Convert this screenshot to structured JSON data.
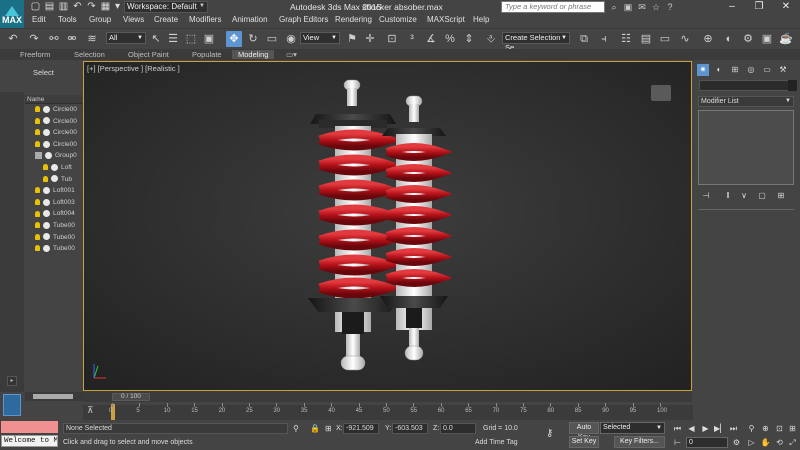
{
  "app": {
    "logo_text": "MAX",
    "title": "Autodesk 3ds Max  2015",
    "file": "shocker absober.max",
    "workspace": "Workspace: Default",
    "search_placeholder": "Type a keyword or phrase"
  },
  "menu": [
    "Edit",
    "Tools",
    "Group",
    "Views",
    "Create",
    "Modifiers",
    "Animation",
    "Graph Editors",
    "Rendering",
    "Customize",
    "MAXScript",
    "Help"
  ],
  "toolbar": {
    "filter": "All",
    "ref_coord": "View",
    "selection_set": "Create Selection Se"
  },
  "ribbon_tabs": [
    "Freeform",
    "Selection",
    "Object Paint",
    "Populate",
    "Modeling"
  ],
  "left_panel": {
    "select_label": "Select",
    "column_header": "Name",
    "items": [
      {
        "label": "Circle00",
        "icon": "bulb"
      },
      {
        "label": "Circle00",
        "icon": "bulb"
      },
      {
        "label": "Circle00",
        "icon": "bulb"
      },
      {
        "label": "Circle00",
        "icon": "bulb"
      },
      {
        "label": "Group0",
        "icon": "group"
      },
      {
        "label": "Loft",
        "icon": "bulb"
      },
      {
        "label": "Tub",
        "icon": "bulb"
      },
      {
        "label": "Loft001",
        "icon": "bulb"
      },
      {
        "label": "Loft003",
        "icon": "bulb"
      },
      {
        "label": "Loft004",
        "icon": "bulb"
      },
      {
        "label": "Tube00",
        "icon": "bulb"
      },
      {
        "label": "Tube00",
        "icon": "bulb"
      },
      {
        "label": "Tube00",
        "icon": "bulb"
      }
    ]
  },
  "viewport": {
    "label": "[+] [Perspective ] [Realistic ]"
  },
  "command_panel": {
    "modifier_list": "Modifier List"
  },
  "timeline": {
    "slider_text": "0 / 100",
    "ticks": [
      "0",
      "5",
      "10",
      "15",
      "20",
      "25",
      "30",
      "35",
      "40",
      "45",
      "50",
      "55",
      "60",
      "65",
      "70",
      "75",
      "80",
      "85",
      "90",
      "95",
      "100"
    ]
  },
  "status": {
    "listener": "Welcome to M",
    "selection": "None Selected",
    "prompt": "Click and drag to select and move objects",
    "x_label": "X:",
    "x_value": "-921.509",
    "y_label": "Y:",
    "y_value": "-603.503",
    "z_label": "Z:",
    "z_value": "0.0",
    "grid": "Grid = 10.0",
    "add_time_tag": "Add Time Tag",
    "auto_key": "Auto Key",
    "set_key": "Set Key",
    "selected": "Selected",
    "key_filters": "Key Filters...",
    "frame": "0"
  },
  "colors": {
    "accent": "#5d95d0",
    "viewport_border": "#c9a13d",
    "spring_red": "#c1151c"
  }
}
